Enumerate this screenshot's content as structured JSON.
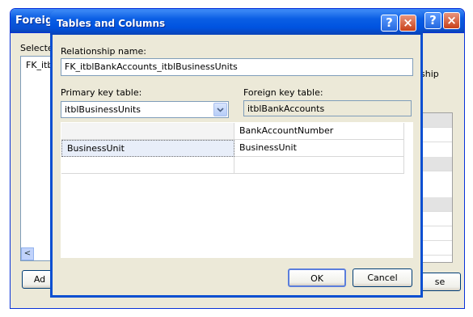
{
  "background_dialog": {
    "title": "Foreign",
    "help_label": "?",
    "close_label": "×",
    "selected_label": "Selected",
    "list_item": "FK_itbl",
    "scroll_left": "<",
    "partial_text_1": "ship",
    "partial_text_2": "unts",
    "add_button": "Ad",
    "close_button": "se"
  },
  "dialog": {
    "title": "Tables and Columns",
    "help_label": "?",
    "close_label": "×",
    "relationship_name_label": "Relationship name:",
    "relationship_name_value": "FK_itblBankAccounts_itblBusinessUnits",
    "primary_key_table_label": "Primary key table:",
    "primary_key_table_value": "itblBusinessUnits",
    "foreign_key_table_label": "Foreign key table:",
    "foreign_key_table_value": "itblBankAccounts",
    "grid": {
      "rows": [
        {
          "primary": "",
          "foreign": "BankAccountNumber"
        },
        {
          "primary": "BusinessUnit",
          "foreign": "BusinessUnit"
        },
        {
          "primary": "",
          "foreign": ""
        }
      ]
    },
    "ok_button": "OK",
    "cancel_button": "Cancel"
  }
}
